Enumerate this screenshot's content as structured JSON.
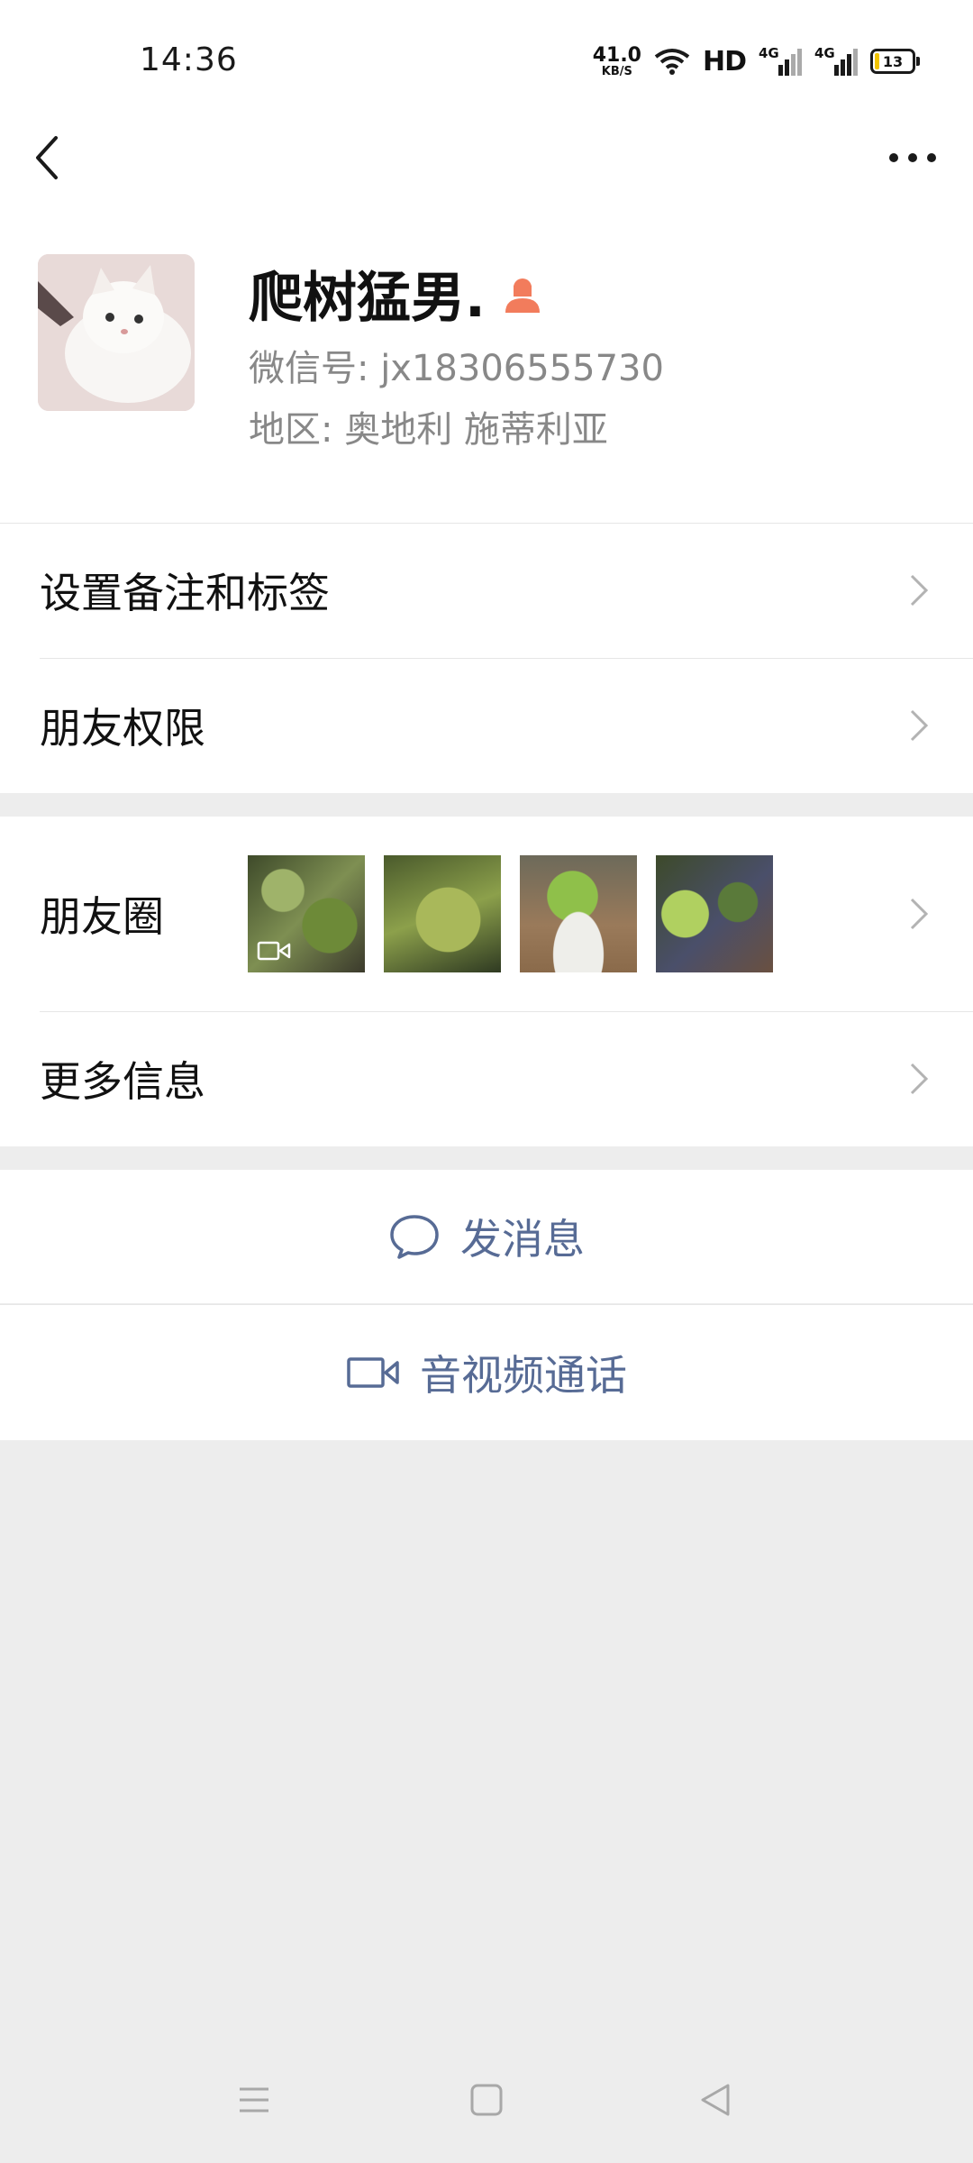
{
  "status_bar": {
    "time": "14:36",
    "net_speed": "41.0",
    "net_speed_unit": "KB/S",
    "hd": "HD",
    "sim1": "4G",
    "sim2": "4G",
    "battery": "13"
  },
  "profile": {
    "name": "爬树猛男.",
    "wechat_id": "微信号: jx18306555730",
    "region": "地区: 奥地利  施蒂利亚"
  },
  "menu": {
    "remark_tags": "设置备注和标签",
    "friend_permissions": "朋友权限",
    "moments": "朋友圈",
    "more_info": "更多信息"
  },
  "actions": {
    "send_message": "发消息",
    "video_call": "音视频通话"
  },
  "colors": {
    "link": "#576b95",
    "background": "#ededed"
  },
  "icons": [
    "back-icon",
    "more-icon",
    "female-icon",
    "chevron-right-icon",
    "message-bubble-icon",
    "video-camera-icon",
    "menu-nav-icon",
    "home-nav-icon",
    "back-nav-icon"
  ]
}
